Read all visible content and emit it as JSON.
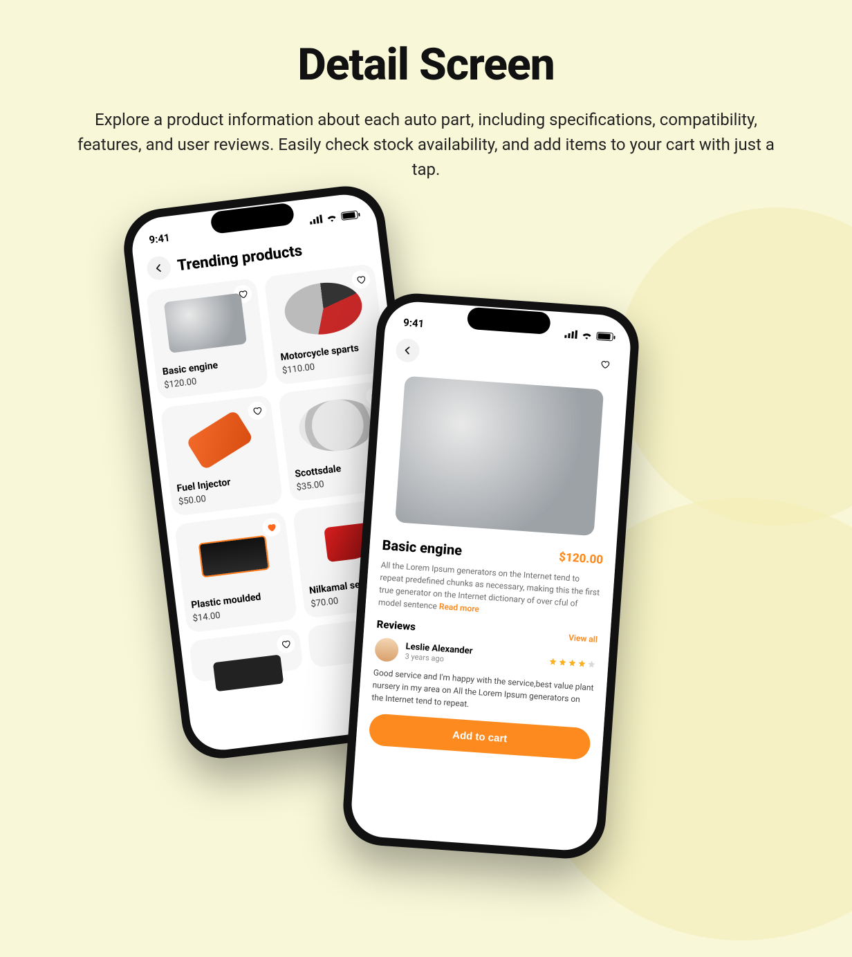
{
  "hero": {
    "title": "Detail Screen",
    "subtitle": "Explore a product information about each auto part, including specifications, compatibility, features, and user reviews. Easily check stock availability, and add items to your cart with just a tap."
  },
  "status": {
    "time": "9:41"
  },
  "trending": {
    "header": "Trending products",
    "products": [
      {
        "name": "Basic engine",
        "price": "$120.00",
        "fav": false,
        "art": "engine"
      },
      {
        "name": "Motorcycle sparts",
        "price": "$110.00",
        "fav": false,
        "art": "moto"
      },
      {
        "name": "Fuel Injector",
        "price": "$50.00",
        "fav": false,
        "art": "injector"
      },
      {
        "name": "Scottsdale",
        "price": "$35.00",
        "fav": true,
        "art": "wheel"
      },
      {
        "name": "Plastic moulded",
        "price": "$14.00",
        "fav": true,
        "art": "box"
      },
      {
        "name": "Nilkamal set",
        "price": "$70.00",
        "fav": false,
        "art": "pump"
      }
    ]
  },
  "detail": {
    "title": "Basic engine",
    "price": "$120.00",
    "description": "All the Lorem Ipsum generators on the Internet tend to repeat predefined  chunks as necessary, making this the first true generator on the  Internet dictionary of over cful of model sentence ",
    "read_more": "Read more",
    "reviews_header": "Reviews",
    "view_all": "View all",
    "review": {
      "name": "Leslie Alexander",
      "time": "3 years ago",
      "stars": 4,
      "text": "Good service and I'm happy with the service,best value plant nursery in my area on All the Lorem Ipsum generators on the Internet tend to repeat."
    },
    "cta": "Add to cart"
  }
}
